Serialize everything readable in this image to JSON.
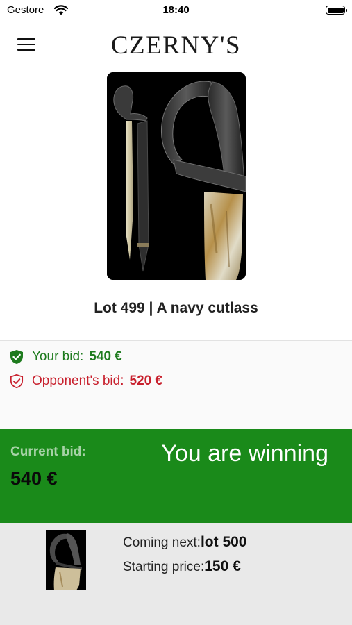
{
  "status_bar": {
    "carrier": "Gestore",
    "time": "18:40",
    "icons": [
      "wifi-icon",
      "battery-icon"
    ]
  },
  "header": {
    "logo": "CZERNY'S",
    "menu_icon": "hamburger-menu-icon"
  },
  "lot": {
    "image": "navy-cutlass-photo",
    "title": "Lot 499 | A navy cutlass"
  },
  "bids": {
    "your_label": "Your bid:",
    "your_value": "540 €",
    "your_icon": "shield-check-filled-icon",
    "opponent_label": "Opponent's bid:",
    "opponent_value": "520 €",
    "opponent_icon": "shield-check-outline-icon"
  },
  "current": {
    "label": "Current bid:",
    "amount": "540 €",
    "status": "You are winning",
    "color": "#1a8a1a"
  },
  "next": {
    "thumb_image": "navy-cutlass-thumbnail",
    "coming_label": "Coming next:",
    "coming_value": "lot 500",
    "price_label": "Starting price:",
    "price_value": "150 €"
  },
  "colors": {
    "winning_green": "#1a8a1a",
    "bid_green": "#1e7b1e",
    "bid_red": "#c8202d"
  }
}
